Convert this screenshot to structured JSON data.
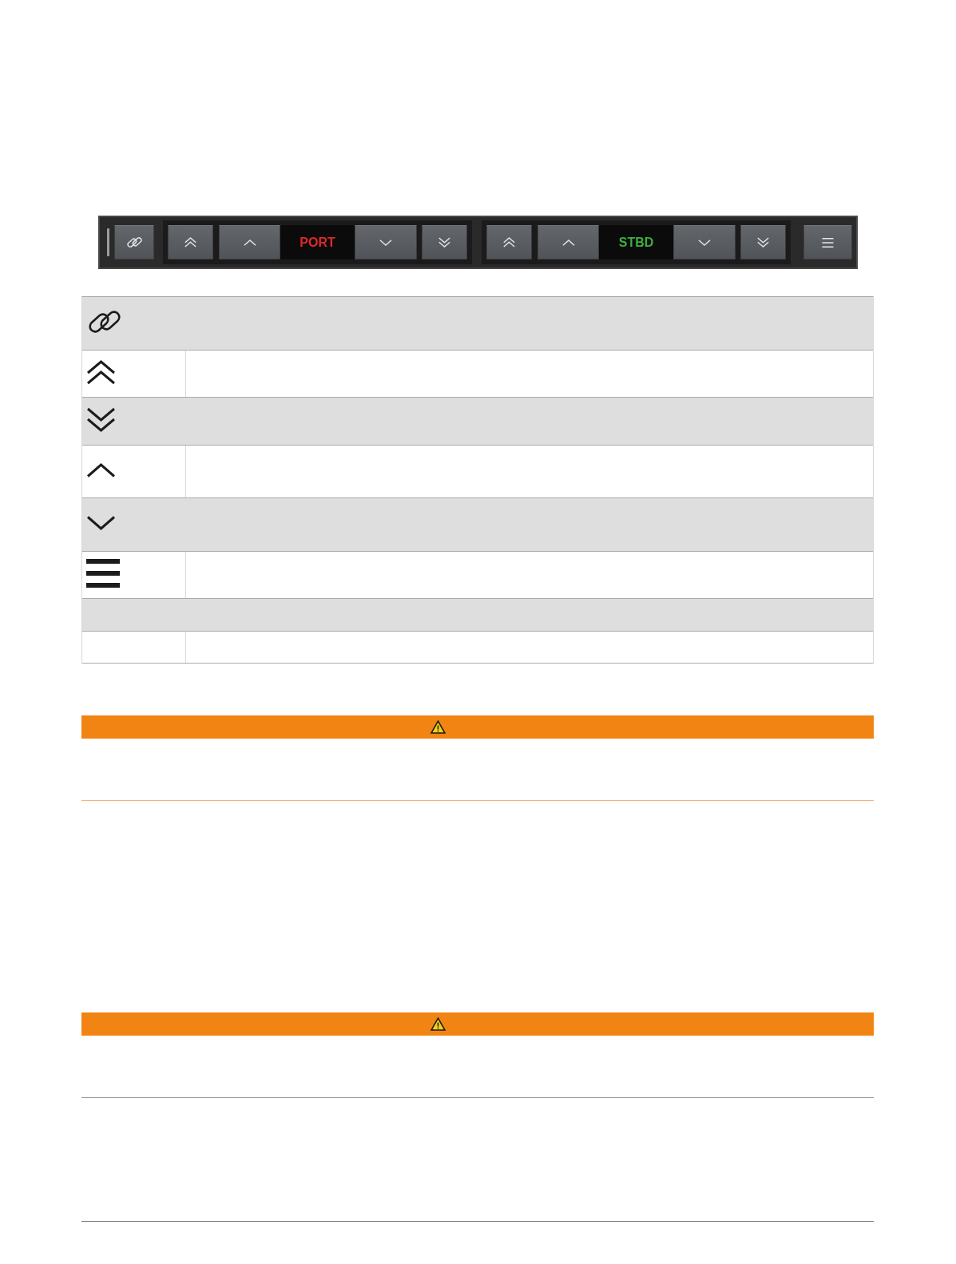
{
  "toolbar": {
    "items": [
      {
        "kind": "link"
      },
      {
        "kind": "group",
        "label": "PORT",
        "color": "#e3262b"
      },
      {
        "kind": "group",
        "label": "STBD",
        "color": "#3fae3f"
      },
      {
        "kind": "menu"
      }
    ]
  },
  "table": {
    "rows": [
      {
        "kind": "span"
      },
      {
        "kind": "split"
      },
      {
        "kind": "span"
      },
      {
        "kind": "split"
      },
      {
        "kind": "span"
      },
      {
        "kind": "split"
      },
      {
        "kind": "span"
      },
      {
        "kind": "split"
      }
    ]
  },
  "warnings": [
    {
      "color": "#f6b27e"
    },
    {
      "color": "#9c9c9c"
    }
  ]
}
